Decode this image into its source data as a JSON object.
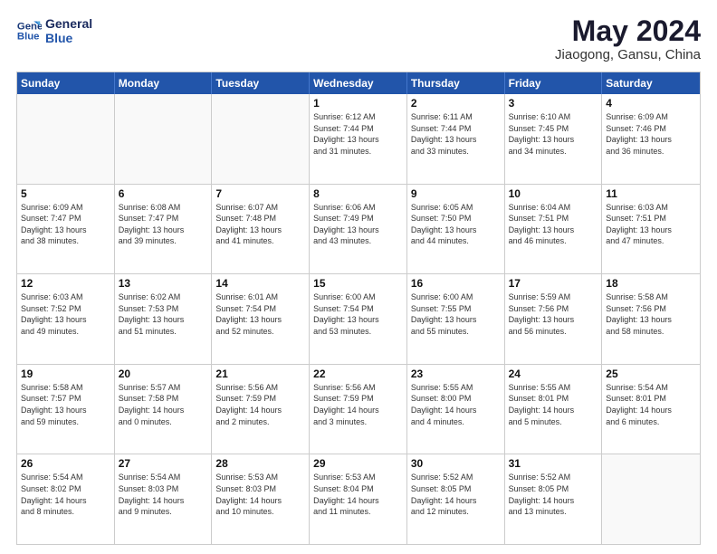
{
  "header": {
    "logo_line1": "General",
    "logo_line2": "Blue",
    "title": "May 2024",
    "subtitle": "Jiaogong, Gansu, China"
  },
  "days": [
    "Sunday",
    "Monday",
    "Tuesday",
    "Wednesday",
    "Thursday",
    "Friday",
    "Saturday"
  ],
  "weeks": [
    [
      {
        "day": "",
        "text": ""
      },
      {
        "day": "",
        "text": ""
      },
      {
        "day": "",
        "text": ""
      },
      {
        "day": "1",
        "text": "Sunrise: 6:12 AM\nSunset: 7:44 PM\nDaylight: 13 hours\nand 31 minutes."
      },
      {
        "day": "2",
        "text": "Sunrise: 6:11 AM\nSunset: 7:44 PM\nDaylight: 13 hours\nand 33 minutes."
      },
      {
        "day": "3",
        "text": "Sunrise: 6:10 AM\nSunset: 7:45 PM\nDaylight: 13 hours\nand 34 minutes."
      },
      {
        "day": "4",
        "text": "Sunrise: 6:09 AM\nSunset: 7:46 PM\nDaylight: 13 hours\nand 36 minutes."
      }
    ],
    [
      {
        "day": "5",
        "text": "Sunrise: 6:09 AM\nSunset: 7:47 PM\nDaylight: 13 hours\nand 38 minutes."
      },
      {
        "day": "6",
        "text": "Sunrise: 6:08 AM\nSunset: 7:47 PM\nDaylight: 13 hours\nand 39 minutes."
      },
      {
        "day": "7",
        "text": "Sunrise: 6:07 AM\nSunset: 7:48 PM\nDaylight: 13 hours\nand 41 minutes."
      },
      {
        "day": "8",
        "text": "Sunrise: 6:06 AM\nSunset: 7:49 PM\nDaylight: 13 hours\nand 43 minutes."
      },
      {
        "day": "9",
        "text": "Sunrise: 6:05 AM\nSunset: 7:50 PM\nDaylight: 13 hours\nand 44 minutes."
      },
      {
        "day": "10",
        "text": "Sunrise: 6:04 AM\nSunset: 7:51 PM\nDaylight: 13 hours\nand 46 minutes."
      },
      {
        "day": "11",
        "text": "Sunrise: 6:03 AM\nSunset: 7:51 PM\nDaylight: 13 hours\nand 47 minutes."
      }
    ],
    [
      {
        "day": "12",
        "text": "Sunrise: 6:03 AM\nSunset: 7:52 PM\nDaylight: 13 hours\nand 49 minutes."
      },
      {
        "day": "13",
        "text": "Sunrise: 6:02 AM\nSunset: 7:53 PM\nDaylight: 13 hours\nand 51 minutes."
      },
      {
        "day": "14",
        "text": "Sunrise: 6:01 AM\nSunset: 7:54 PM\nDaylight: 13 hours\nand 52 minutes."
      },
      {
        "day": "15",
        "text": "Sunrise: 6:00 AM\nSunset: 7:54 PM\nDaylight: 13 hours\nand 53 minutes."
      },
      {
        "day": "16",
        "text": "Sunrise: 6:00 AM\nSunset: 7:55 PM\nDaylight: 13 hours\nand 55 minutes."
      },
      {
        "day": "17",
        "text": "Sunrise: 5:59 AM\nSunset: 7:56 PM\nDaylight: 13 hours\nand 56 minutes."
      },
      {
        "day": "18",
        "text": "Sunrise: 5:58 AM\nSunset: 7:56 PM\nDaylight: 13 hours\nand 58 minutes."
      }
    ],
    [
      {
        "day": "19",
        "text": "Sunrise: 5:58 AM\nSunset: 7:57 PM\nDaylight: 13 hours\nand 59 minutes."
      },
      {
        "day": "20",
        "text": "Sunrise: 5:57 AM\nSunset: 7:58 PM\nDaylight: 14 hours\nand 0 minutes."
      },
      {
        "day": "21",
        "text": "Sunrise: 5:56 AM\nSunset: 7:59 PM\nDaylight: 14 hours\nand 2 minutes."
      },
      {
        "day": "22",
        "text": "Sunrise: 5:56 AM\nSunset: 7:59 PM\nDaylight: 14 hours\nand 3 minutes."
      },
      {
        "day": "23",
        "text": "Sunrise: 5:55 AM\nSunset: 8:00 PM\nDaylight: 14 hours\nand 4 minutes."
      },
      {
        "day": "24",
        "text": "Sunrise: 5:55 AM\nSunset: 8:01 PM\nDaylight: 14 hours\nand 5 minutes."
      },
      {
        "day": "25",
        "text": "Sunrise: 5:54 AM\nSunset: 8:01 PM\nDaylight: 14 hours\nand 6 minutes."
      }
    ],
    [
      {
        "day": "26",
        "text": "Sunrise: 5:54 AM\nSunset: 8:02 PM\nDaylight: 14 hours\nand 8 minutes."
      },
      {
        "day": "27",
        "text": "Sunrise: 5:54 AM\nSunset: 8:03 PM\nDaylight: 14 hours\nand 9 minutes."
      },
      {
        "day": "28",
        "text": "Sunrise: 5:53 AM\nSunset: 8:03 PM\nDaylight: 14 hours\nand 10 minutes."
      },
      {
        "day": "29",
        "text": "Sunrise: 5:53 AM\nSunset: 8:04 PM\nDaylight: 14 hours\nand 11 minutes."
      },
      {
        "day": "30",
        "text": "Sunrise: 5:52 AM\nSunset: 8:05 PM\nDaylight: 14 hours\nand 12 minutes."
      },
      {
        "day": "31",
        "text": "Sunrise: 5:52 AM\nSunset: 8:05 PM\nDaylight: 14 hours\nand 13 minutes."
      },
      {
        "day": "",
        "text": ""
      }
    ]
  ]
}
